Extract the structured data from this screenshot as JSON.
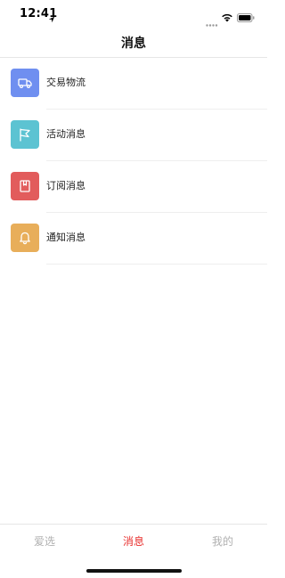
{
  "status_bar": {
    "time": "12:41",
    "icons": [
      "location-arrow-icon",
      "signal-dots-icon",
      "wifi-icon",
      "battery-icon"
    ]
  },
  "nav": {
    "title": "消息"
  },
  "list": {
    "items": [
      {
        "label": "交易物流",
        "icon": "truck-icon",
        "color": "#6f8ff0"
      },
      {
        "label": "活动消息",
        "icon": "flag-icon",
        "color": "#5cc3d2"
      },
      {
        "label": "订阅消息",
        "icon": "bookmark-icon",
        "color": "#e25c5c"
      },
      {
        "label": "通知消息",
        "icon": "bell-icon",
        "color": "#e8ae5a"
      }
    ]
  },
  "tab_bar": {
    "tabs": [
      {
        "label": "爱选",
        "active": false
      },
      {
        "label": "消息",
        "active": true
      },
      {
        "label": "我的",
        "active": false
      }
    ],
    "active_color": "#e8312f",
    "inactive_color": "#b0b0b0"
  }
}
